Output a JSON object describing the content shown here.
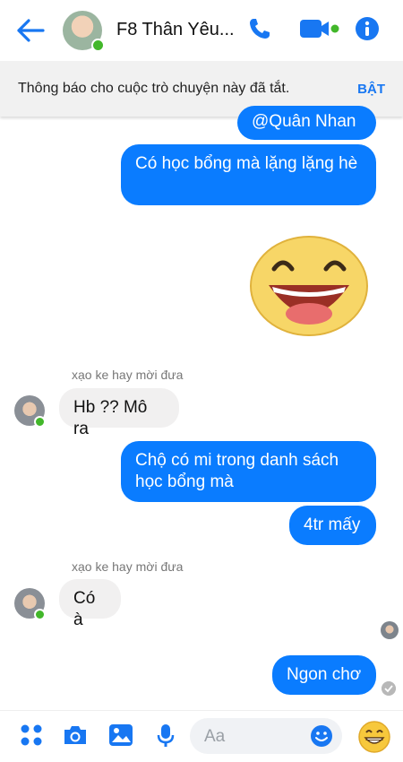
{
  "header": {
    "title": "F8 Thân Yêu..."
  },
  "notice": {
    "text": "Thông báo cho cuộc trò chuyện này đã tắt.",
    "button": "BẬT"
  },
  "messages": {
    "mention": "@Quân Nhan",
    "m1": "Có học bổng mà lặng lặng hè",
    "sender1": "xạo ke hay mời đưa",
    "m2": "Hb ?? Mô ra",
    "m3": "Chộ có mi trong danh sách học bổng mà",
    "m4": "4tr mấy",
    "sender2": "xạo ke hay mời đưa",
    "m5": "Có à",
    "m6": "Ngon chơ"
  },
  "composer": {
    "placeholder": "Aa"
  },
  "icons": {
    "back": "back-arrow-icon",
    "call": "phone-icon",
    "video": "video-camera-icon",
    "info": "info-icon",
    "apps": "four-dots-icon",
    "camera": "camera-icon",
    "gallery": "image-icon",
    "mic": "microphone-icon",
    "emoji": "smiley-icon",
    "reaction": "grinning-emoji-icon"
  },
  "colors": {
    "accent": "#0a7cff",
    "online": "#42b72a",
    "incoming": "#f1f0f0"
  }
}
